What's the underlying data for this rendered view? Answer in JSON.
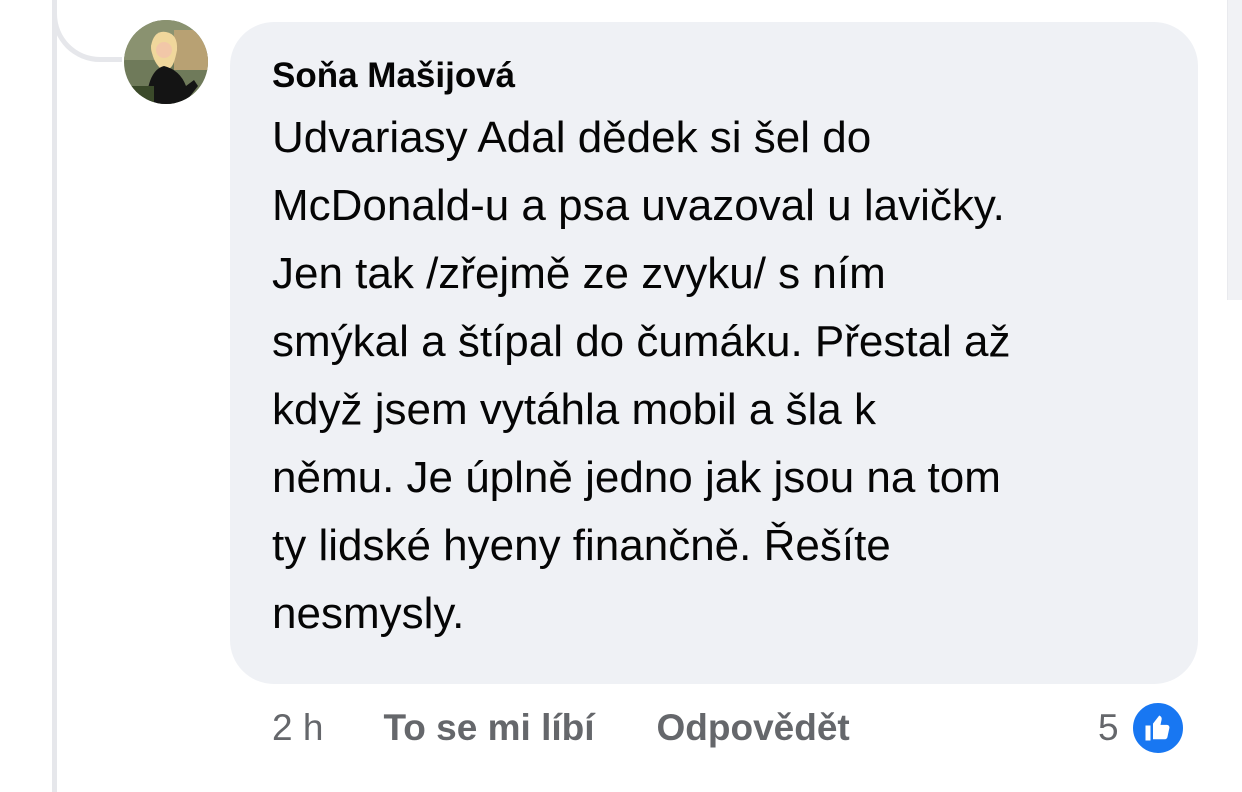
{
  "comment": {
    "author": "Soňa Mašijová",
    "text": "Udvariasy Adal dědek si šel do\nMcDonald-u a psa uvazoval u lavičky.\nJen tak /zřejmě ze zvyku/ s ním\nsmýkal a štípal do čumáku. Přestal až\nkdyž jsem vytáhla mobil a šla k\nněmu. Je úplně jedno jak jsou na tom\nty lidské hyeny finančně. Řešíte\nnesmysly.",
    "avatar_icon": "profile-photo",
    "time": "2 h",
    "like_label": "To se mi líbí",
    "reply_label": "Odpovědět",
    "reaction_count": "5",
    "reaction_icon": "thumbs-up-icon",
    "colors": {
      "bubble": "#eff1f5",
      "text": "#050505",
      "meta": "#65676b",
      "like_badge": "#1877f2"
    }
  }
}
